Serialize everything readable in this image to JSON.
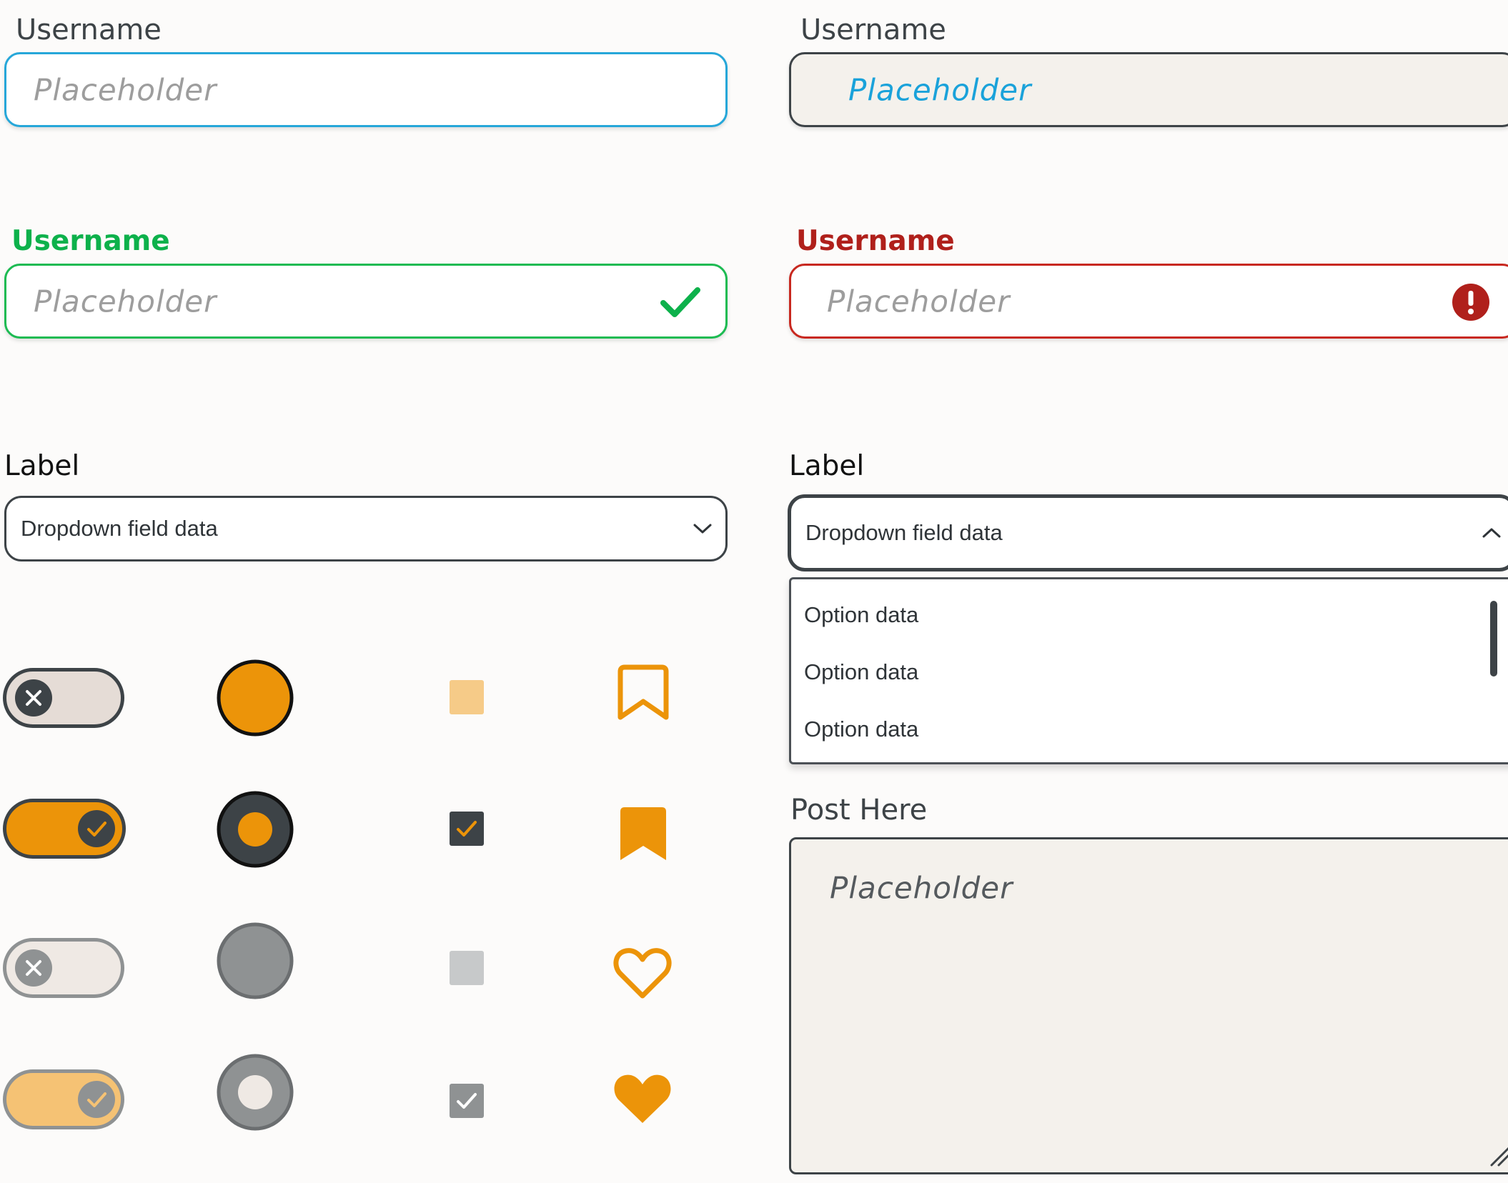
{
  "colors": {
    "focus": "#26a7d9",
    "success": "#1cbb52",
    "error": "#c8281f",
    "accent": "#ec9409",
    "dark": "#3d4347"
  },
  "fields": {
    "focused": {
      "label": "Username",
      "placeholder": "Placeholder"
    },
    "filled": {
      "label": "Username",
      "placeholder": "Placeholder"
    },
    "success": {
      "label": "Username",
      "placeholder": "Placeholder",
      "icon": "checkmark-icon"
    },
    "error": {
      "label": "Username",
      "placeholder": "Placeholder",
      "icon": "error-icon"
    }
  },
  "dropdowns": {
    "closed": {
      "label": "Label",
      "value": "Dropdown field data",
      "icon": "chevron-down-icon"
    },
    "open": {
      "label": "Label",
      "value": "Dropdown field data",
      "icon": "chevron-up-icon",
      "options": [
        "Option data",
        "Option data",
        "Option data"
      ]
    }
  },
  "post": {
    "label": "Post Here",
    "placeholder": "Placeholder"
  },
  "controls": {
    "toggles": [
      "off",
      "on",
      "off-disabled",
      "on-disabled"
    ],
    "radios": [
      "unselected",
      "selected",
      "unselected-disabled",
      "selected-disabled"
    ],
    "checkboxes": [
      "unchecked",
      "checked",
      "unchecked-disabled",
      "checked-disabled"
    ],
    "icons": [
      "bookmark-outline-icon",
      "bookmark-filled-icon",
      "heart-outline-icon",
      "heart-filled-icon"
    ]
  }
}
